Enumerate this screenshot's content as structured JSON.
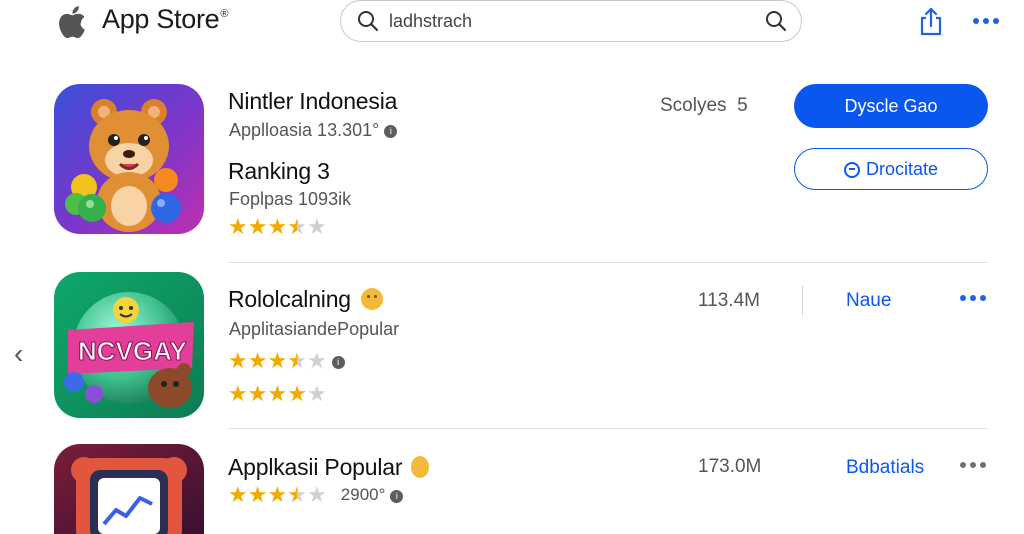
{
  "header": {
    "title": "App Store",
    "title_mark": "®",
    "search_value": "ladhstrach"
  },
  "apps": [
    {
      "name": "Nintler Indonesia",
      "sub1": "Applloasia 13.301°",
      "ranking_label": "Ranking 3",
      "sub2": "Foplpas 1093ik",
      "rating": 3.5,
      "meta": "Scolyes  5",
      "primary_button": "Dyscle Gao",
      "secondary_button": "Drocitate"
    },
    {
      "name": "Rololcalning",
      "sub1": "ApplitasiandePopular",
      "rating": 3.5,
      "rating2": 4,
      "size": "113.4M",
      "action": "Naue"
    },
    {
      "name": "Applkasii Popular",
      "rating": 3.5,
      "count": "2900°",
      "size": "173.0M",
      "action": "Bdbatials"
    }
  ],
  "icons": {
    "logo": "apple-logo",
    "search": "search-icon",
    "share": "share-icon",
    "more": "more-icon",
    "back": "chevron-left-icon"
  },
  "colors": {
    "accent": "#0a57f0",
    "star": "#f2a900"
  }
}
